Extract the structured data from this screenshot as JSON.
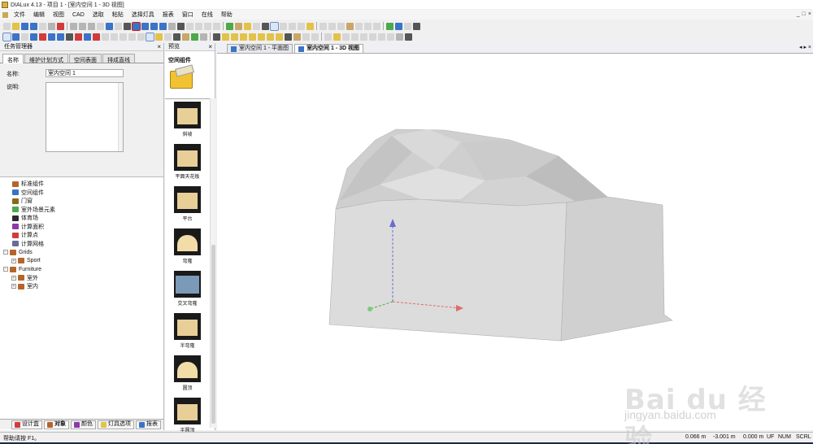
{
  "window": {
    "title": "DIALux 4.13 - 项目 1 - [室内空间 1 - 3D 视图]"
  },
  "menu": {
    "items": [
      "文件",
      "编辑",
      "视图",
      "CAD",
      "选取",
      "粘贴",
      "选择灯具",
      "报表",
      "窗口",
      "在线",
      "帮助"
    ],
    "mdi_controls": [
      "_",
      "□",
      "×"
    ]
  },
  "left_panel": {
    "title": "任务管理器",
    "close": "×",
    "tabs": [
      "名称",
      "维护计划方式",
      "空间表面",
      "排成直线"
    ],
    "properties": {
      "name_label": "名称:",
      "name_value": "室内空间 1",
      "desc_label": "说明:"
    },
    "tree": [
      {
        "label": "标准组件",
        "indent": 1,
        "exp": "",
        "color": "#b5652a"
      },
      {
        "label": "空间组件",
        "indent": 1,
        "exp": "",
        "color": "#3b73c6"
      },
      {
        "label": "门窗",
        "indent": 1,
        "exp": "",
        "color": "#8a6a1a"
      },
      {
        "label": "室外场景元素",
        "indent": 1,
        "exp": "",
        "color": "#4caa4a"
      },
      {
        "label": "体育场",
        "indent": 1,
        "exp": "",
        "color": "#2a2a2a"
      },
      {
        "label": "计算面积",
        "indent": 1,
        "exp": "",
        "color": "#8a3aa8"
      },
      {
        "label": "计算点",
        "indent": 1,
        "exp": "",
        "color": "#d23b3b"
      },
      {
        "label": "计算网格",
        "indent": 1,
        "exp": "",
        "color": "#6a6a9a"
      },
      {
        "label": "Grids",
        "indent": 0,
        "exp": "−",
        "color": "#b5652a"
      },
      {
        "label": "Sport",
        "indent": 2,
        "exp": "+",
        "color": "#b5652a"
      },
      {
        "label": "Furniture",
        "indent": 0,
        "exp": "−",
        "color": "#b5652a"
      },
      {
        "label": "室外",
        "indent": 2,
        "exp": "+",
        "color": "#b5652a"
      },
      {
        "label": "室内",
        "indent": 2,
        "exp": "+",
        "color": "#b5652a"
      }
    ],
    "bottom_tabs": [
      {
        "label": "设计盒",
        "color": "#d23b3b"
      },
      {
        "label": "对象",
        "color": "#b5652a",
        "active": true
      },
      {
        "label": "颜色",
        "color": "#8a3aa8"
      },
      {
        "label": "灯具选项",
        "color": "#e2c24a"
      },
      {
        "label": "报表",
        "color": "#3b73c6"
      }
    ]
  },
  "preview_panel": {
    "title": "预览",
    "close": "×",
    "header": "空间组件",
    "items": [
      "斜坡",
      "平面天花板",
      "平台",
      "弯隆",
      "交叉弯隆",
      "半弯隆",
      "圆顶",
      "半圆顶"
    ]
  },
  "document": {
    "tabs": [
      {
        "label": "室内空间 1 - 平面图",
        "active": false
      },
      {
        "label": "室内空间 1 - 3D 视图",
        "active": true
      }
    ],
    "nav": "◂ ▸ ×"
  },
  "statusbar": {
    "help": "帮助请按 F1。",
    "x": "0.066 m",
    "y": "-3.001 m",
    "z": "0.000 m",
    "flags": [
      "UF",
      "NUM",
      "SCRL"
    ]
  },
  "watermark": {
    "brand": "Bai du 经验",
    "url": "jingyan.baidu.com"
  }
}
